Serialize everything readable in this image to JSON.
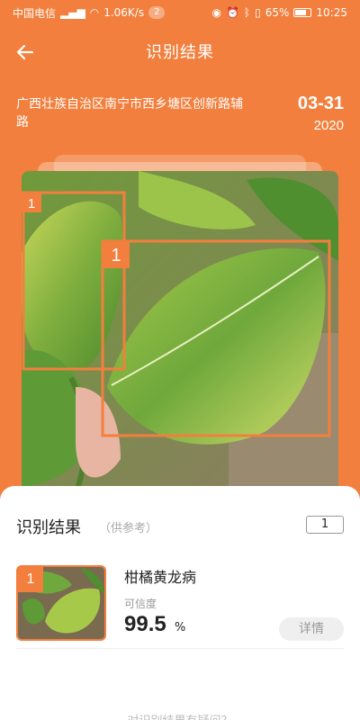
{
  "status_bar": {
    "carrier": "中国电信",
    "net_speed": "1.06K/s",
    "notification_count": "2",
    "battery": "65%",
    "time": "10:25"
  },
  "header": {
    "back_icon": "arrow-left-icon",
    "title": "识别结果"
  },
  "location": "广西壮族自治区南宁市西乡塘区创新路辅路",
  "date": {
    "month_day": "03-31",
    "year": "2020"
  },
  "photo": {
    "detections": [
      {
        "label": "1"
      },
      {
        "label": "1"
      }
    ],
    "accent_color": "#F27F3D"
  },
  "results": {
    "title": "识别结果",
    "note": "（供参考）",
    "count": "1",
    "items": [
      {
        "index": "1",
        "name": "柑橘黄龙病",
        "confidence_label": "可信度",
        "confidence": "99.5",
        "confidence_unit": "%",
        "detail_label": "详情"
      }
    ]
  },
  "footer": {
    "question": "对识别结果有疑问？"
  }
}
